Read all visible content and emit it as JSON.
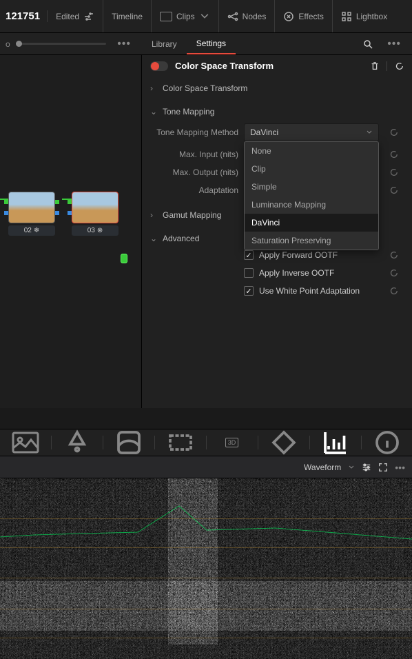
{
  "toolbar": {
    "title": "121751",
    "edited": "Edited",
    "timeline": "Timeline",
    "clips": "Clips",
    "nodes": "Nodes",
    "effects": "Effects",
    "lightbox": "Lightbox"
  },
  "tabs": {
    "library": "Library",
    "settings": "Settings"
  },
  "inspector": {
    "title": "Color Space Transform",
    "sections": {
      "cst": "Color Space Transform",
      "tone_mapping": "Tone Mapping",
      "gamut_mapping": "Gamut Mapping",
      "advanced": "Advanced"
    },
    "fields": {
      "tone_mapping_method": "Tone Mapping Method",
      "max_input": "Max. Input (nits)",
      "max_output": "Max. Output (nits)",
      "adaptation": "Adaptation"
    },
    "tone_mapping_value": "DaVinci",
    "tone_mapping_options": [
      "None",
      "Clip",
      "Simple",
      "Luminance Mapping",
      "DaVinci",
      "Saturation Preserving"
    ],
    "checkboxes": {
      "forward_ootf": "Apply Forward OOTF",
      "inverse_ootf": "Apply Inverse OOTF",
      "white_point": "Use White Point Adaptation"
    }
  },
  "nodes": {
    "n02": "02",
    "n03": "03"
  },
  "scopes": {
    "waveform": "Waveform",
    "three_d": "3D"
  }
}
